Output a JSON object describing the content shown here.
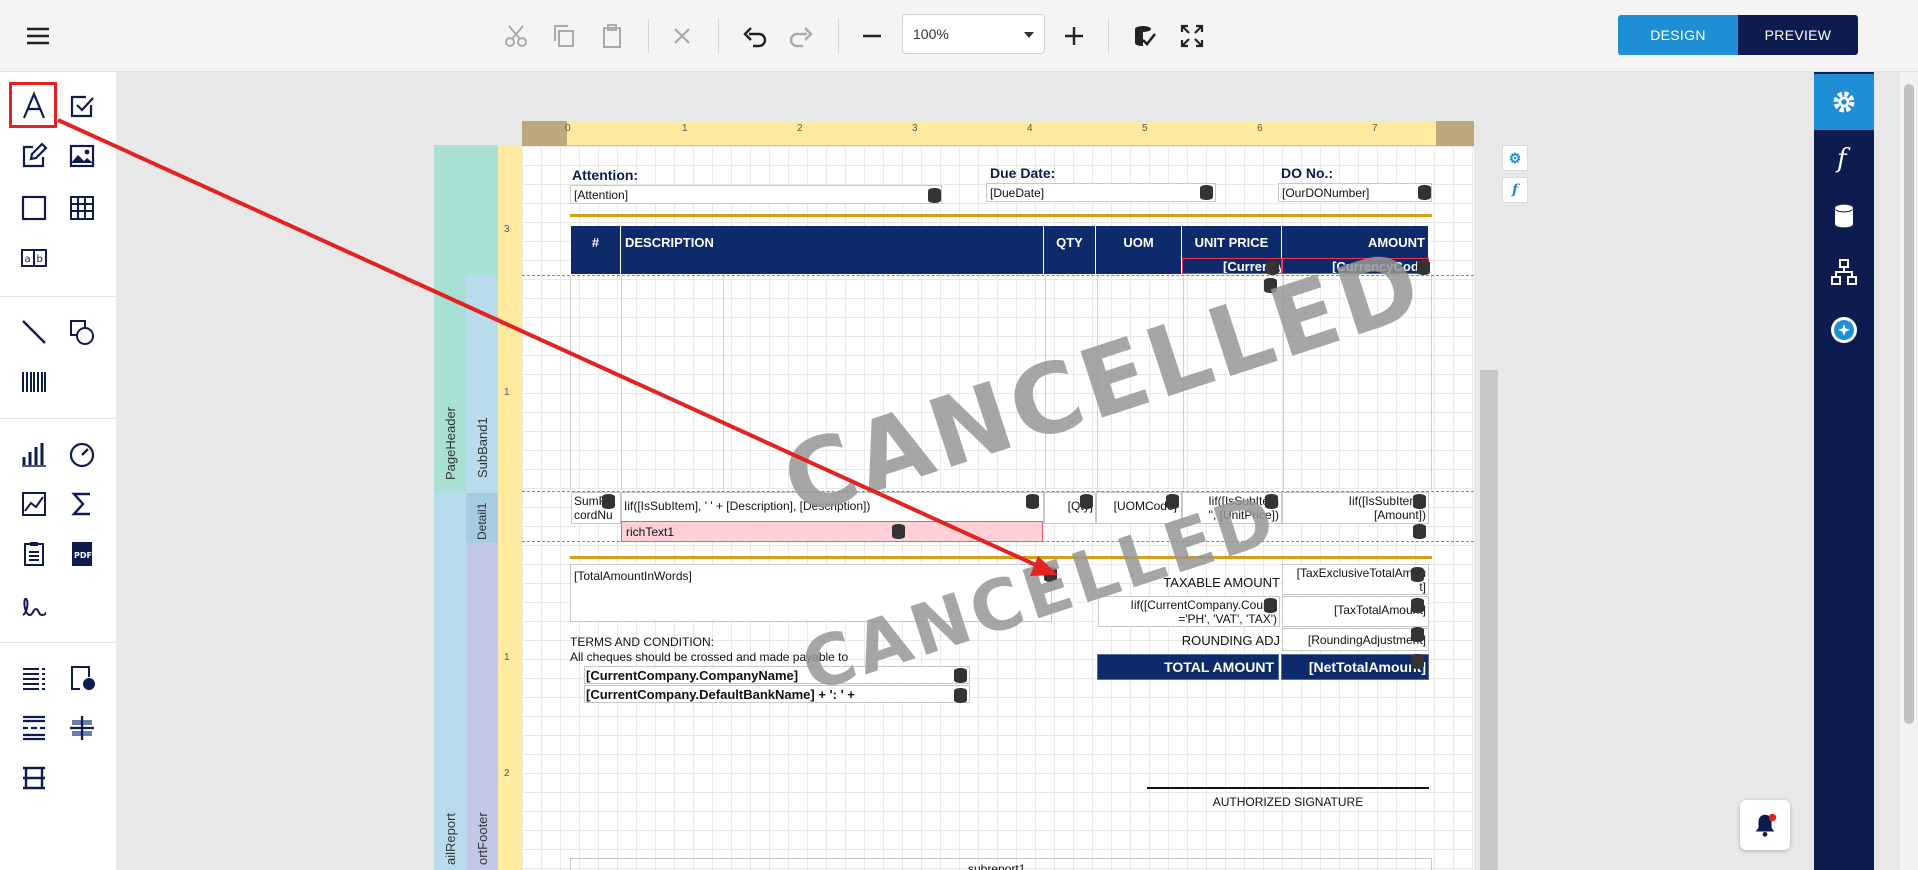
{
  "toolbar": {
    "zoom": "100%",
    "design": "DESIGN",
    "preview": "PREVIEW"
  },
  "bands": {
    "page_header": "PageHeader",
    "subband": "SubBand1",
    "detail": "Detail1",
    "detail_report": "ailReport",
    "report_footer": "ortFooter"
  },
  "ruler": {
    "top": [
      "0",
      "1",
      "2",
      "3",
      "4",
      "5",
      "6",
      "7"
    ],
    "left": [
      "3",
      "1",
      "1",
      "2"
    ]
  },
  "report": {
    "attention_label": "Attention:",
    "attention_field": "[Attention]",
    "due_label": "Due Date:",
    "due_field": "[DueDate]",
    "do_label": "DO No.:",
    "do_field": "[OurDONumber]",
    "headers": [
      "#",
      "DESCRIPTION",
      "QTY",
      "UOM",
      "UNIT PRICE",
      "AMOUNT"
    ],
    "currency1": "[CurrencyCo",
    "currency2": "[CurrencyCode",
    "detail": {
      "c1a": "SumR",
      "c1b": "cordNu",
      "c2": "Iif([IsSubItem], '   ' + [Description], [Description])",
      "c3": "[Qty]",
      "c4": "[UOMCode]",
      "c5a": "Iif([IsSubItem",
      "c5b": "'', [UnitPrice])",
      "c6a": "Iif([IsSubItem],",
      "c6b": "[Amount])",
      "rich": "richText1"
    },
    "words": "[TotalAmountInWords]",
    "taxable": "TAXABLE AMOUNT",
    "tax_excl": "[TaxExclusiveTotalAmou",
    "tax_excl2": "t]",
    "country1": "Iif([CurrentCompany.Countr",
    "country2": "='PH', 'VAT', 'TAX')",
    "tax_total": "[TaxTotalAmount]",
    "rounding": "ROUNDING ADJ",
    "rounding_field": "[RoundingAdjustment]",
    "total": "TOTAL AMOUNT",
    "net_total": "[NetTotalAmount]",
    "terms1": "TERMS AND CONDITION:",
    "terms2": "All cheques should be crossed and made payable to",
    "company": "[CurrentCompany.CompanyName]",
    "bank": "[CurrentCompany.DefaultBankName] + ': ' +",
    "signature": "AUTHORIZED SIGNATURE",
    "subreport": "subreport1",
    "watermark": "CANCELLED"
  },
  "colors": {
    "accent": "#1e8fd4",
    "navy": "#0d1b4e",
    "annotation": "#e32222"
  }
}
